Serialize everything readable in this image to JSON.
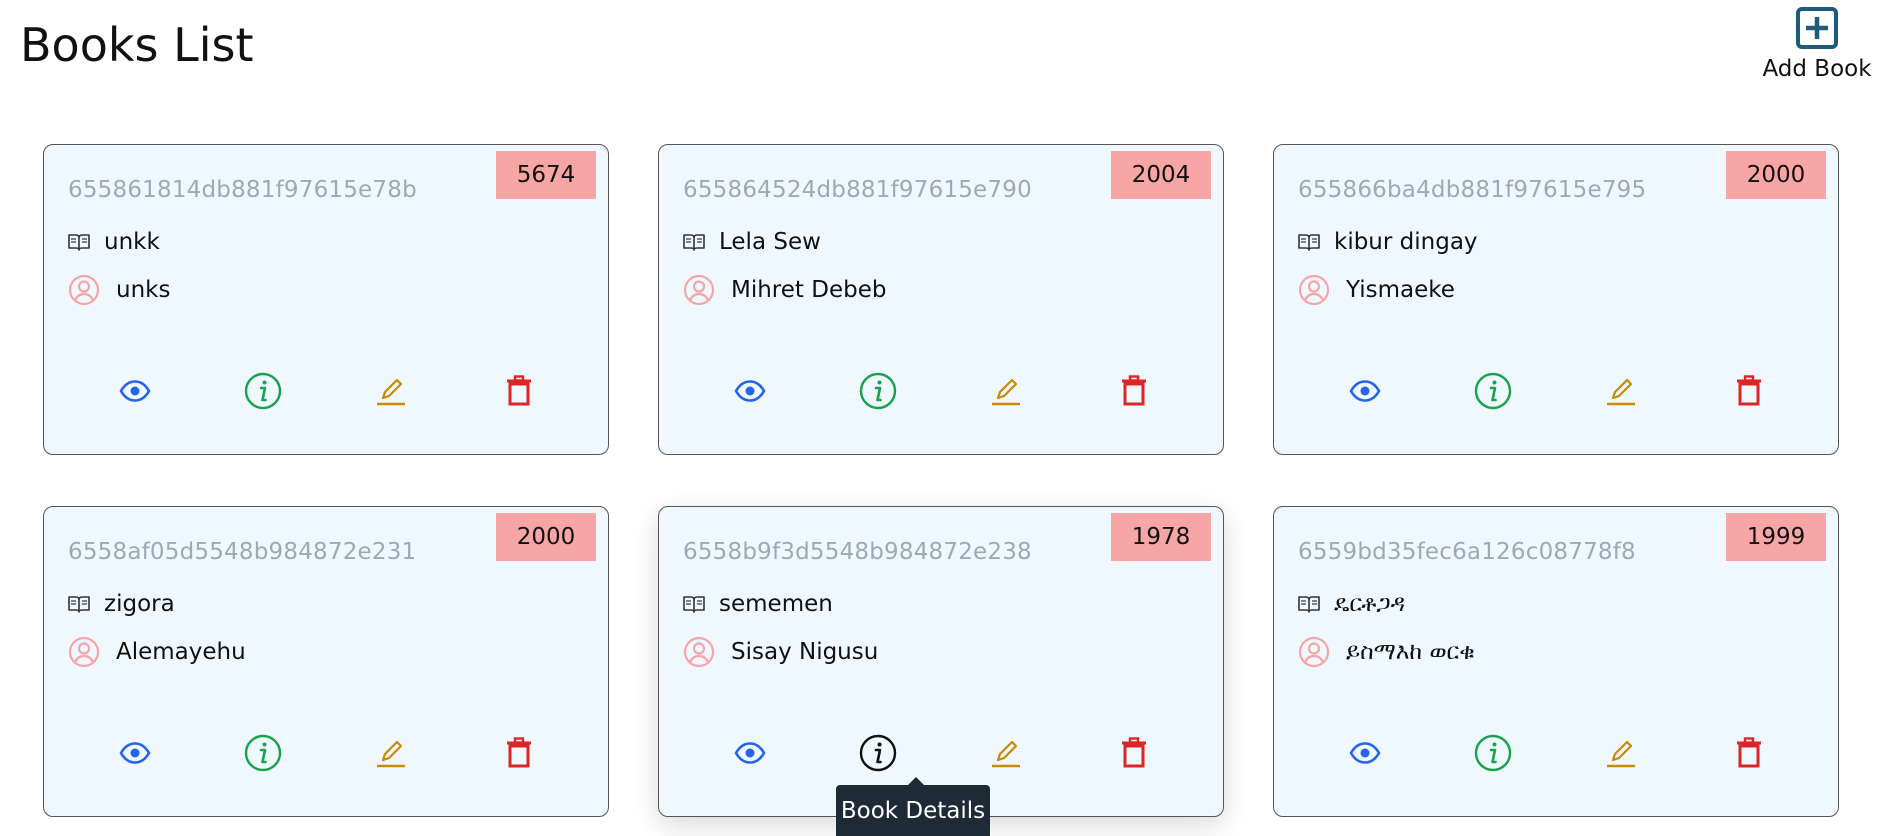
{
  "header": {
    "title": "Books List",
    "add_book_label": "Add Book",
    "add_icon": "plus-square-icon"
  },
  "colors": {
    "card_background": "#f0f8ff",
    "year_badge": "#f8a5a5",
    "id_text": "#a0a8b0",
    "view_icon": "#2563eb",
    "info_icon": "#16a34a",
    "edit_icon": "#ca8a04",
    "delete_icon": "#dc2626",
    "author_icon": "#f8a5a5",
    "add_icon": "#1e5a7a"
  },
  "books": [
    {
      "id": "655861814db881f97615e78b",
      "year": "5674",
      "title": "unkk",
      "author": "unks"
    },
    {
      "id": "655864524db881f97615e790",
      "year": "2004",
      "title": "Lela Sew",
      "author": "Mihret Debeb"
    },
    {
      "id": "655866ba4db881f97615e795",
      "year": "2000",
      "title": "kibur dingay",
      "author": "Yismaeke"
    },
    {
      "id": "6558af05d5548b984872e231",
      "year": "2000",
      "title": "zigora",
      "author": "Alemayehu"
    },
    {
      "id": "6558b9f3d5548b984872e238",
      "year": "1978",
      "title": "sememen",
      "author": "Sisay Nigusu"
    },
    {
      "id": "6559bd35fec6a126c08778f8",
      "year": "1999",
      "title": "ዴርቶጋዳ",
      "author": "ይስማእከ ወርቁ"
    }
  ],
  "tooltip": {
    "text": "Book Details"
  }
}
